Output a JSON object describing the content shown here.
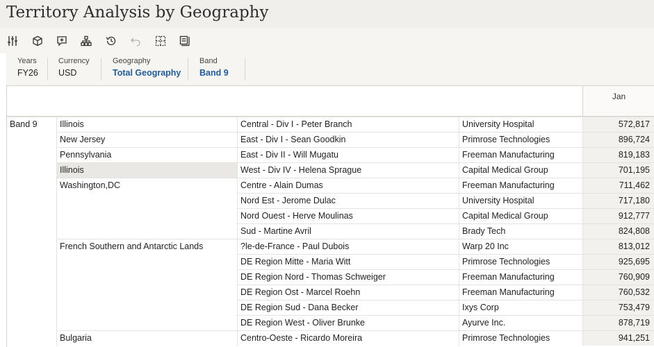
{
  "page": {
    "title": "Territory Analysis by Geography"
  },
  "toolbar": {
    "icons": [
      "sliders-icon",
      "cube-icon",
      "add-note-icon",
      "hierarchy-icon",
      "history-icon",
      "undo-icon",
      "grid-select-icon",
      "panel-icon"
    ]
  },
  "pov": {
    "years": {
      "label": "Years",
      "value": "FY26"
    },
    "currency": {
      "label": "Currency",
      "value": "USD"
    },
    "geography": {
      "label": "Geography",
      "value": "Total Geography"
    },
    "band": {
      "label": "Band",
      "value": "Band 9"
    }
  },
  "grid": {
    "column_header": "Jan",
    "band_label": "Band 9",
    "rows": [
      {
        "geography": "Illinois",
        "territory": "Central -  Div I - Peter Branch",
        "customer": "University Hospital",
        "value": "572,817"
      },
      {
        "geography": "New Jersey",
        "territory": "East -  Div I - Sean Goodkin",
        "customer": "Primrose Technologies",
        "value": "896,724"
      },
      {
        "geography": "Pennsylvania",
        "territory": "East -  Div II - Will Mugatu",
        "customer": "Freeman Manufacturing",
        "value": "819,183"
      },
      {
        "geography": "Illinois",
        "territory": "West -  Div IV - Helena Sprague",
        "customer": "Capital Medical Group",
        "value": "701,195"
      },
      {
        "geography": "Washington,DC",
        "territory": "Centre - Alain Dumas",
        "customer": "Freeman Manufacturing",
        "value": "711,462"
      },
      {
        "geography": "",
        "territory": "Nord Est - Jerome Dulac",
        "customer": "University Hospital",
        "value": "717,180"
      },
      {
        "geography": "",
        "territory": "Nord Ouest - Herve Moulinas",
        "customer": "Capital Medical Group",
        "value": "912,777"
      },
      {
        "geography": "",
        "territory": "Sud - Martine Avril",
        "customer": "Brady Tech",
        "value": "824,808"
      },
      {
        "geography": "French Southern and Antarctic Lands",
        "territory": "?le-de-France - Paul Dubois",
        "customer": "Warp 20 Inc",
        "value": "813,012"
      },
      {
        "geography": "",
        "territory": "DE Region Mitte - Maria Witt",
        "customer": "Primrose Technologies",
        "value": "925,695"
      },
      {
        "geography": "",
        "territory": "DE Region Nord - Thomas Schweiger",
        "customer": "Freeman Manufacturing",
        "value": "760,909"
      },
      {
        "geography": "",
        "territory": "DE Region Ost - Marcel Roehn",
        "customer": "Freeman Manufacturing",
        "value": "760,532"
      },
      {
        "geography": "",
        "territory": "DE Region Sud - Dana Becker",
        "customer": "Ixys Corp",
        "value": "753,479"
      },
      {
        "geography": "",
        "territory": "DE Region West - Oliver Brunke",
        "customer": "Ayurve Inc.",
        "value": "878,719"
      },
      {
        "geography": "Bulgaria",
        "territory": "Centro-Oeste - Ricardo Moreira",
        "customer": "Primrose Technologies",
        "value": "941,251"
      }
    ]
  }
}
